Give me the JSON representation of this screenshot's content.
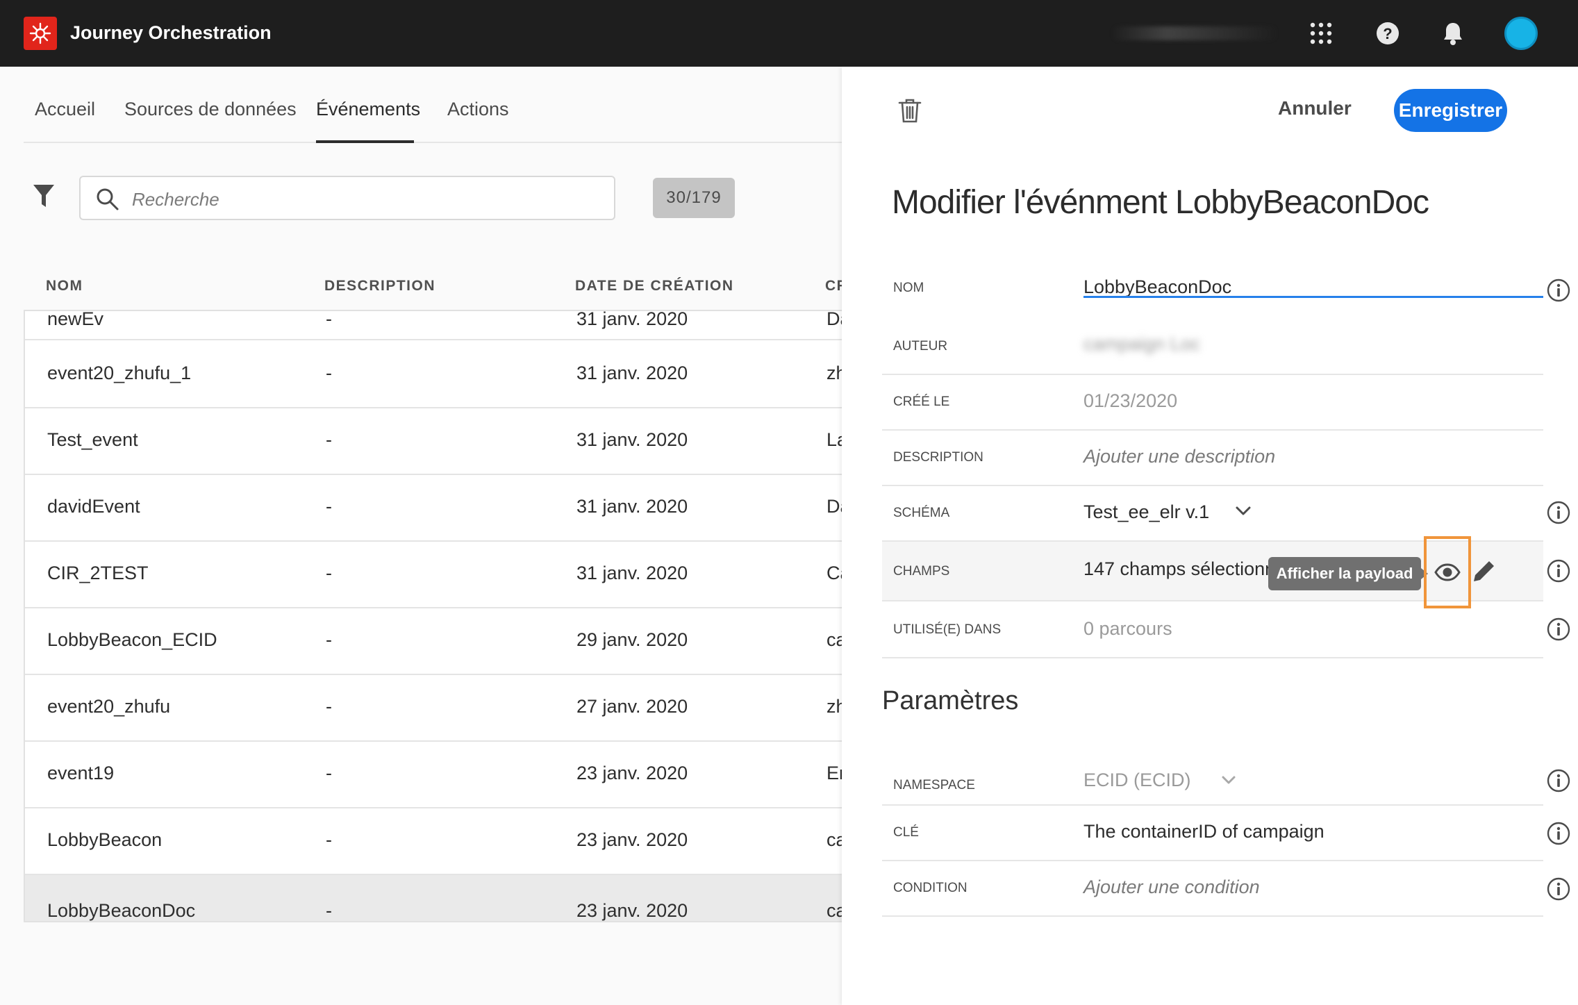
{
  "app": {
    "title": "Journey Orchestration",
    "accent": "#e1251b"
  },
  "topbar": {
    "icons": [
      "apps-grid-icon",
      "help-icon",
      "bell-icon",
      "avatar"
    ]
  },
  "nav": {
    "tabs": [
      {
        "label": "Accueil"
      },
      {
        "label": "Sources de données"
      },
      {
        "label": "Événements"
      },
      {
        "label": "Actions"
      }
    ],
    "active_tab": "Événements"
  },
  "search": {
    "placeholder": "Recherche",
    "count": "30/179"
  },
  "table": {
    "columns": [
      "NOM",
      "DESCRIPTION",
      "DATE DE CRÉATION",
      "CR"
    ],
    "rows": [
      {
        "name": "newEv",
        "description": "-",
        "date": "31 janv. 2020",
        "creator": "Da"
      },
      {
        "name": "event20_zhufu_1",
        "description": "-",
        "date": "31 janv. 2020",
        "creator": "zh"
      },
      {
        "name": "Test_event",
        "description": "-",
        "date": "31 janv. 2020",
        "creator": "La"
      },
      {
        "name": "davidEvent",
        "description": "-",
        "date": "31 janv. 2020",
        "creator": "Da"
      },
      {
        "name": "CIR_2TEST",
        "description": "-",
        "date": "31 janv. 2020",
        "creator": "Ca"
      },
      {
        "name": "LobbyBeacon_ECID",
        "description": "-",
        "date": "29 janv. 2020",
        "creator": "ca"
      },
      {
        "name": "event20_zhufu",
        "description": "-",
        "date": "27 janv. 2020",
        "creator": "zh"
      },
      {
        "name": "event19",
        "description": "-",
        "date": "23 janv. 2020",
        "creator": "Er"
      },
      {
        "name": "LobbyBeacon",
        "description": "-",
        "date": "23 janv. 2020",
        "creator": "ca"
      },
      {
        "name": "LobbyBeaconDoc",
        "description": "-",
        "date": "23 janv. 2020",
        "creator": "ca"
      }
    ]
  },
  "panel": {
    "cancel_label": "Annuler",
    "save_label": "Enregistrer",
    "title": "Modifier l'événment LobbyBeaconDoc",
    "fields": {
      "name": {
        "label": "NOM",
        "value": "LobbyBeaconDoc"
      },
      "author": {
        "label": "AUTEUR",
        "value": "campaign Loc"
      },
      "created": {
        "label": "CRÉÉ LE",
        "value": "01/23/2020"
      },
      "description": {
        "label": "DESCRIPTION",
        "placeholder": "Ajouter une description"
      },
      "schema": {
        "label": "SCHÉMA",
        "value": "Test_ee_elr v.1"
      },
      "fields": {
        "label": "CHAMPS",
        "value": "147 champs sélectionné",
        "tooltip": "Afficher la payload"
      },
      "used_in": {
        "label": "UTILISÉ(E) DANS",
        "value": "0 parcours"
      }
    },
    "params_title": "Paramètres",
    "params": {
      "namespace": {
        "label": "NAMESPACE",
        "value": "ECID (ECID)"
      },
      "key": {
        "label": "CLÉ",
        "value": "The containerID of campaign"
      },
      "condition": {
        "label": "CONDITION",
        "placeholder": "Ajouter une condition"
      }
    },
    "highlight_color": "#f0953b",
    "primary_color": "#1473e6"
  }
}
